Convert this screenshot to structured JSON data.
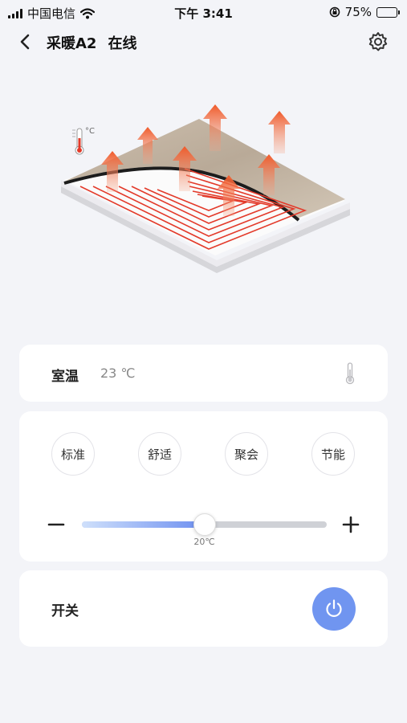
{
  "status_bar": {
    "carrier": "中国电信",
    "time": "下午 3:41",
    "battery": "75%",
    "battery_level": 0.75,
    "icons": [
      "signal-icon",
      "wifi-icon",
      "rotation-lock-icon",
      "battery-icon"
    ]
  },
  "navbar": {
    "device_name": "采暖A2",
    "status": "在线",
    "icons": [
      "back-icon",
      "gear-icon"
    ]
  },
  "illustration": {
    "temp_unit_label": "°C"
  },
  "room_temp": {
    "label": "室温",
    "value": "23 ℃",
    "icon": "thermometer-icon"
  },
  "modes": [
    {
      "label": "标准"
    },
    {
      "label": "舒适"
    },
    {
      "label": "聚会"
    },
    {
      "label": "节能"
    }
  ],
  "setpoint": {
    "value": "20℃",
    "level": 0.5,
    "minus_icon": "minus-icon",
    "plus_icon": "plus-icon"
  },
  "power": {
    "label": "开关",
    "icon": "power-icon",
    "color": "#7095f0"
  },
  "colors": {
    "background": "#f3f4f8",
    "accent": "#7095f0",
    "heat_arrow": "#f06a3a",
    "heat_pipe": "#e33a2a"
  }
}
